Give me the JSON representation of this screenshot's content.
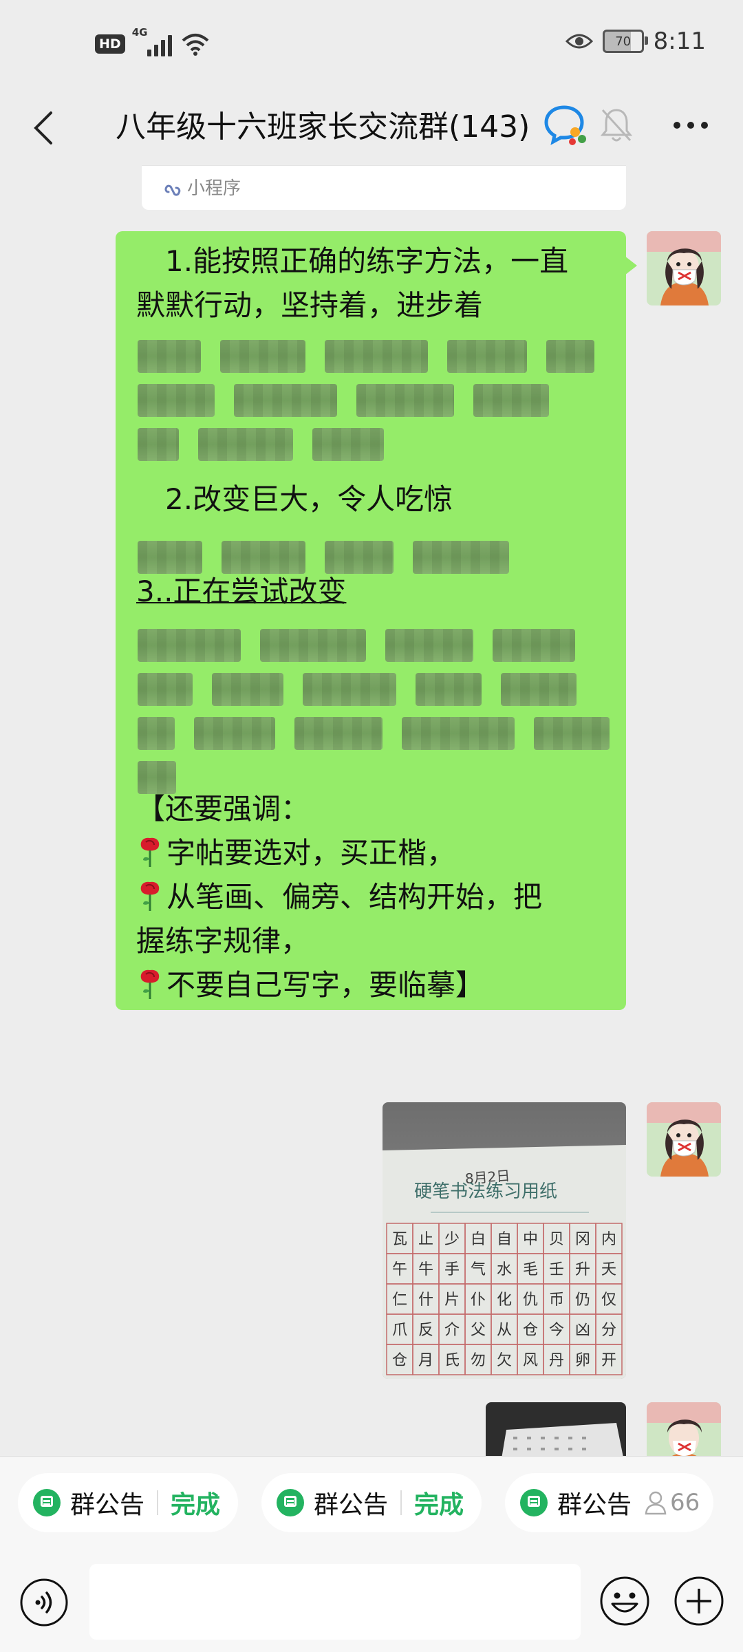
{
  "status_bar": {
    "hd_badge": "HD",
    "network_type": "4G",
    "battery_level": "70",
    "time": "8:11"
  },
  "nav": {
    "title": "八年级十六班家长交流群(143)",
    "icons": [
      "back-arrow-icon",
      "group-chat-icon",
      "mute-bell-icon",
      "more-icon"
    ]
  },
  "chat": {
    "mini_program_label": "小程序",
    "message": {
      "lines": [
        "　1.能按照正确的练字方法，一直",
        "默默行动，坚持着，进步着",
        "　2.改变巨大，令人吃惊",
        "3..正在尝试改变",
        "【还要强调：",
        "字帖要选对，买正楷，",
        "从笔画、偏旁、结构开始，把",
        "握练字规律，",
        "不要自己写字，要临摹】"
      ],
      "bubble_color": "#95ec69"
    },
    "photo1_caption": "硬笔书法练习用纸",
    "photo1_handwritten": "8月2日",
    "practice_chars": [
      "瓦",
      "止",
      "少",
      "白",
      "自",
      "中",
      "贝",
      "冈",
      "内",
      "午",
      "牛",
      "手",
      "气",
      "水",
      "毛",
      "壬",
      "升",
      "夭",
      "仁",
      "什",
      "片",
      "仆",
      "化",
      "仇",
      "币",
      "仍",
      "仅",
      "爪",
      "反",
      "介",
      "父",
      "从",
      "仓",
      "今",
      "凶",
      "分",
      "仓",
      "月",
      "氏",
      "勿",
      "欠",
      "风",
      "丹",
      "卵",
      "开"
    ]
  },
  "bottom": {
    "chips": [
      {
        "label": "群公告",
        "action": "完成"
      },
      {
        "label": "群公告",
        "action": "完成"
      },
      {
        "label": "群公告",
        "count": "66"
      }
    ],
    "accent_color": "#23b360"
  }
}
